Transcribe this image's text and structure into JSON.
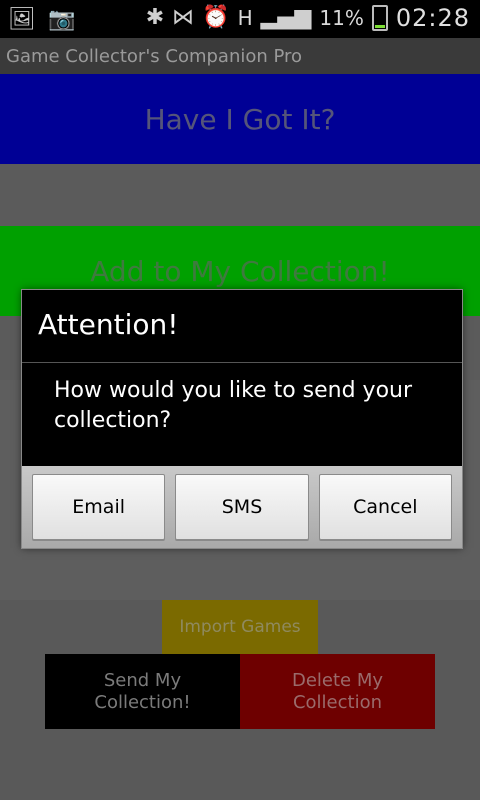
{
  "status_bar": {
    "battery": "11%",
    "signal": "H",
    "time": "02:28",
    "icons": [
      "image-icon",
      "camera-icon",
      "bluetooth-icon",
      "network-icon",
      "alarm-icon",
      "signal-icon",
      "battery-icon"
    ]
  },
  "app": {
    "title": "Game Collector's Companion Pro"
  },
  "main": {
    "have_label": "Have I Got It?",
    "add_label": "Add to My Collection!",
    "import_label": "Import Games",
    "send_label": "Send My\nCollection!",
    "delete_label": "Delete My\nCollection"
  },
  "dialog": {
    "title": "Attention!",
    "message": "How would you like to send your collection?",
    "buttons": {
      "email": "Email",
      "sms": "SMS",
      "cancel": "Cancel"
    }
  },
  "colors": {
    "have_bg": "#000095",
    "add_bg": "#00a000",
    "import_bg": "#7b6a00",
    "send_bg": "#000000",
    "delete_bg": "#6e0000"
  }
}
